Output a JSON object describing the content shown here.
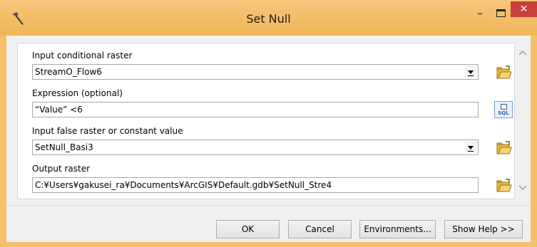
{
  "window": {
    "title": "Set Null"
  },
  "icons": {
    "app": "hammer-icon",
    "minimize": "minimize-icon",
    "maximize": "maximize-icon",
    "close": "close-icon",
    "folder": "folder-open-icon",
    "sql": "sql-query-icon"
  },
  "titlebar": {
    "minimize_glyph": "–",
    "close_glyph": "✕"
  },
  "form": {
    "input_conditional_raster": {
      "label": "Input conditional raster",
      "value": "StreamO_Flow6"
    },
    "expression": {
      "label": "Expression (optional)",
      "value": "“Value” <6",
      "sql_label": "SQL"
    },
    "input_false_raster": {
      "label": "Input false raster or constant value",
      "value": "SetNull_Basi3"
    },
    "output_raster": {
      "label": "Output raster",
      "value": "C:¥Users¥gakusei_ra¥Documents¥ArcGIS¥Default.gdb¥SetNull_Stre4"
    }
  },
  "buttons": {
    "ok": "OK",
    "cancel": "Cancel",
    "environments": "Environments...",
    "show_help": "Show Help >>"
  },
  "colors": {
    "titlebar": "#f6c579",
    "close": "#c7403a"
  }
}
